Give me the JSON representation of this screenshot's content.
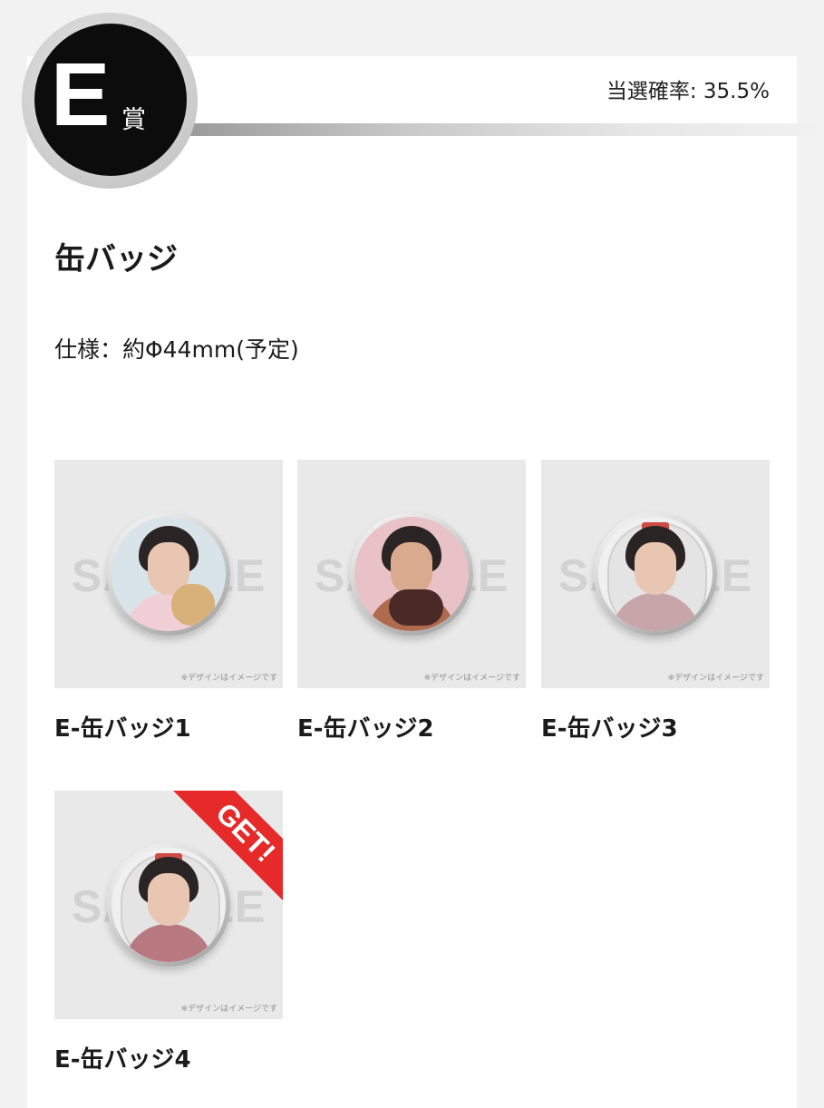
{
  "prize": {
    "grade_letter": "E",
    "grade_suffix": "賞",
    "probability": "当選確率: 35.5%",
    "title": "缶バッジ",
    "spec": "仕様：約Φ44mm(予定)"
  },
  "items": [
    {
      "name": "E-缶バッジ1",
      "watermark": "SAMPLE",
      "disclaimer": "※デザインはイメージです",
      "got": false
    },
    {
      "name": "E-缶バッジ2",
      "watermark": "SAMPLE",
      "disclaimer": "※デザインはイメージです",
      "got": false
    },
    {
      "name": "E-缶バッジ3",
      "watermark": "SAMPLE",
      "disclaimer": "※デザインはイメージです",
      "got": false
    },
    {
      "name": "E-缶バッジ4",
      "watermark": "SAMPLE",
      "disclaimer": "※デザインはイメージです",
      "got": true,
      "get_label": "GET!"
    }
  ],
  "colors": {
    "badge": "#0c0c0c",
    "get_ribbon": "#e62a2a",
    "thumb_bg": "#e9e9e9"
  }
}
